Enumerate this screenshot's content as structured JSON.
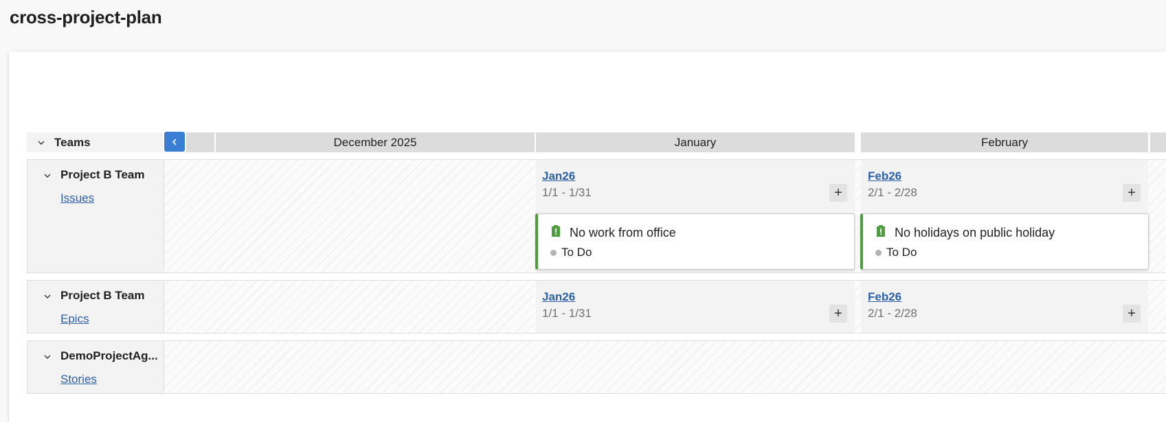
{
  "page": {
    "title": "cross-project-plan"
  },
  "header": {
    "teams_label": "Teams",
    "months": [
      "December 2025",
      "January",
      "February"
    ]
  },
  "rows": [
    {
      "team": "Project B Team",
      "backlog": "Issues",
      "iterations": [
        {
          "name": "Jan26",
          "dates": "1/1 - 1/31",
          "add": "+"
        },
        {
          "name": "Feb26",
          "dates": "2/1 - 2/28",
          "add": "+"
        }
      ],
      "cards": [
        {
          "title": "No work from office",
          "state": "To Do",
          "icon": "issue-icon",
          "color": "#4f9d3f"
        },
        {
          "title": "No holidays on public holiday",
          "state": "To Do",
          "icon": "issue-icon",
          "color": "#4f9d3f"
        }
      ]
    },
    {
      "team": "Project B Team",
      "backlog": "Epics",
      "iterations": [
        {
          "name": "Jan26",
          "dates": "1/1 - 1/31",
          "add": "+"
        },
        {
          "name": "Feb26",
          "dates": "2/1 - 2/28",
          "add": "+"
        }
      ]
    },
    {
      "team": "DemoProjectAg...",
      "backlog": "Stories"
    }
  ],
  "colors": {
    "accent": "#3b7fd4",
    "link": "#2b5fa6",
    "issue": "#4f9d3f",
    "todo_dot": "#b2b2b2"
  }
}
